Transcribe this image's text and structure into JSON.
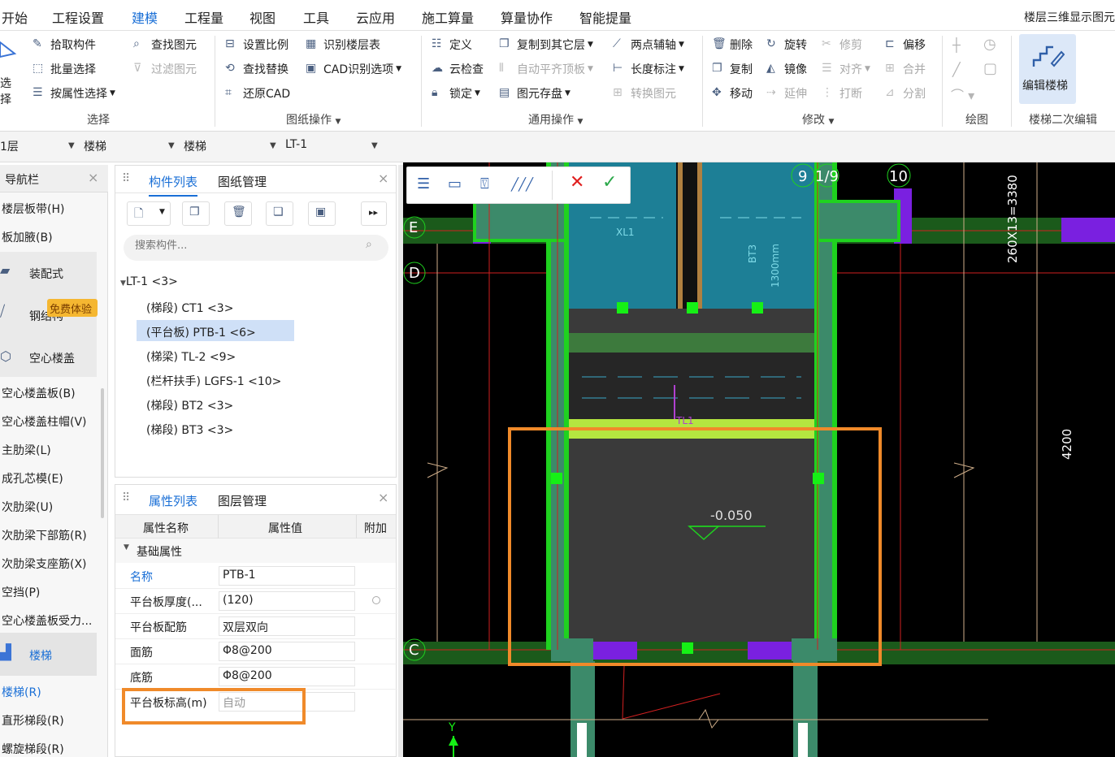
{
  "menu": {
    "items": [
      "开始",
      "工程设置",
      "建模",
      "工程量",
      "视图",
      "工具",
      "云应用",
      "施工算量",
      "算量协作",
      "智能提量"
    ],
    "active": "建模",
    "right_text": "楼层三维显示图元"
  },
  "ribbon": {
    "select_group": {
      "big": "选择",
      "items": [
        "拾取构件",
        "批量选择",
        "按属性选择",
        "查找图元",
        "过滤图元"
      ],
      "label": "选择"
    },
    "drawing_group": {
      "items": [
        "设置比例",
        "识别楼层表",
        "查找替换",
        "CAD识别选项",
        "还原CAD"
      ],
      "label": "图纸操作"
    },
    "common_group": {
      "items": [
        "定义",
        "复制到其它层",
        "两点辅轴",
        "云检查",
        "自动平齐顶板",
        "长度标注",
        "锁定",
        "图元存盘",
        "转换图元"
      ],
      "label": "通用操作"
    },
    "modify_group": {
      "items": [
        "删除",
        "旋转",
        "修剪",
        "偏移",
        "复制",
        "镜像",
        "对齐",
        "合并",
        "移动",
        "延伸",
        "打断",
        "分割"
      ],
      "label": "修改"
    },
    "draw_group": {
      "label": "绘图"
    },
    "stair_group": {
      "button": "编辑楼梯",
      "label": "楼梯二次编辑"
    }
  },
  "selectors": [
    "1层",
    "楼梯",
    "楼梯",
    "LT-1"
  ],
  "nav": {
    "title": "导航栏",
    "items": [
      "楼层板带(H)",
      "板加腋(B)",
      "装配式",
      "钢结构",
      "空心楼盖",
      "空心楼盖板(B)",
      "空心楼盖柱帽(V)",
      "主肋梁(L)",
      "成孔芯模(E)",
      "次肋梁(U)",
      "次肋梁下部筋(R)",
      "次肋梁支座筋(X)",
      "空挡(P)",
      "空心楼盖板受力...",
      "楼梯",
      "楼梯(R)",
      "直形梯段(R)",
      "螺旋梯段(R)"
    ],
    "badge": "免费体验"
  },
  "component_panel": {
    "tabs": [
      "构件列表",
      "图纸管理"
    ],
    "search_placeholder": "搜索构件...",
    "tree": [
      "LT-1 <3>",
      "(梯段) CT1 <3>",
      "(平台板) PTB-1 <6>",
      "(梯梁) TL-2 <9>",
      "(栏杆扶手) LGFS-1 <10>",
      "(梯段) BT2 <3>",
      "(梯段) BT3 <3>"
    ],
    "selected_index": 2
  },
  "property_panel": {
    "tabs": [
      "属性列表",
      "图层管理"
    ],
    "headers": [
      "属性名称",
      "属性值",
      "附加"
    ],
    "section": "基础属性",
    "rows": [
      {
        "name": "名称",
        "value": "PTB-1"
      },
      {
        "name": "平台板厚度(...",
        "value": "(120)"
      },
      {
        "name": "平台板配筋",
        "value": "双层双向"
      },
      {
        "name": "面筋",
        "value": "Φ8@200"
      },
      {
        "name": "底筋",
        "value": "Φ8@200"
      },
      {
        "name": "平台板标高(m)",
        "value": "自动"
      }
    ]
  },
  "cad": {
    "axis_labels": [
      "E",
      "D",
      "C",
      "9",
      "1/9",
      "10"
    ],
    "dims": [
      "260X13=3380",
      "4200"
    ],
    "texts": [
      "XL1",
      "BT3",
      "1300mm",
      "TL1",
      "-0.050",
      "Y"
    ]
  },
  "colors": {
    "accent": "#1a6fd6",
    "highlight": "#f08a2a",
    "cad_green": "#1fd21f"
  }
}
